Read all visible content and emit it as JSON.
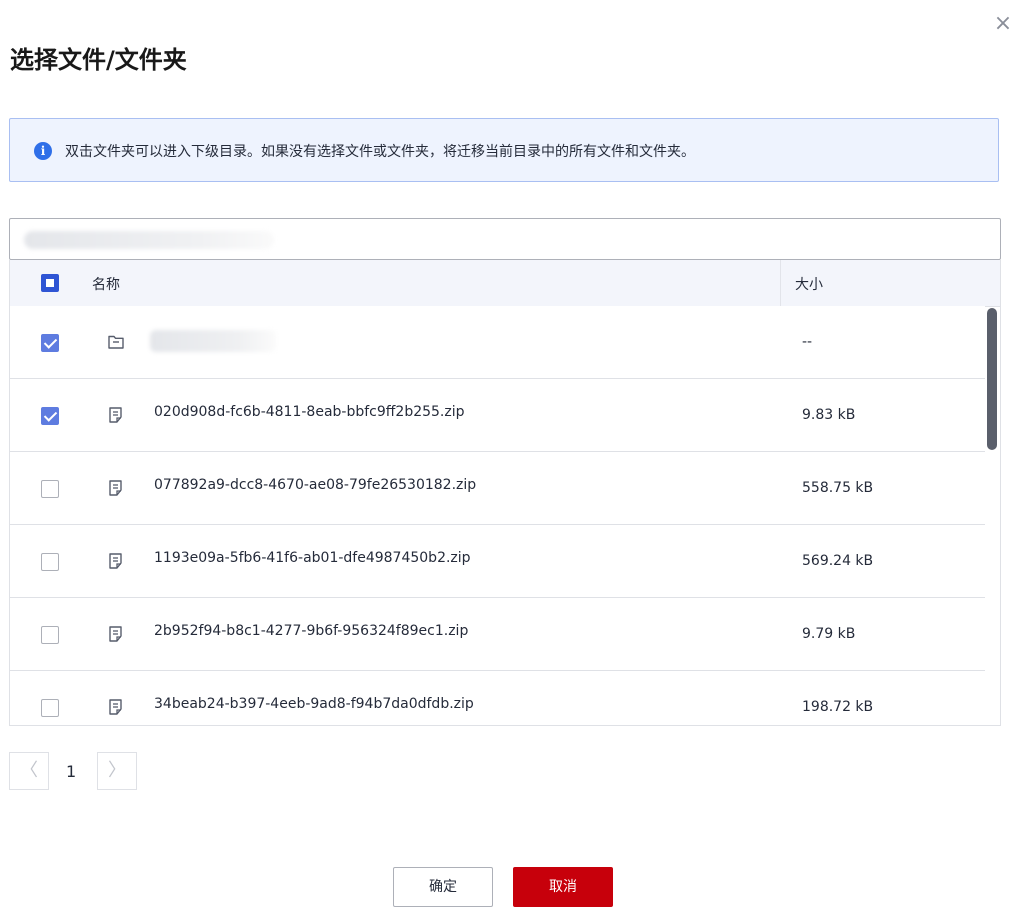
{
  "dialog": {
    "title": "选择文件/文件夹",
    "close_symbol": "×",
    "notice": "双击文件夹可以进入下级目录。如果没有选择文件或文件夹，将迁移当前目录中的所有文件和文件夹。"
  },
  "table": {
    "columns": {
      "name": "名称",
      "size": "大小"
    },
    "header_checkbox": "partial",
    "rows": [
      {
        "type": "folder",
        "icon": "folder-icon",
        "name": "",
        "size": "--",
        "checked": true
      },
      {
        "type": "file",
        "icon": "file-icon",
        "name": "020d908d-fc6b-4811-8eab-bbfc9ff2b255.zip",
        "size": "9.83 kB",
        "checked": true
      },
      {
        "type": "file",
        "icon": "file-icon",
        "name": "077892a9-dcc8-4670-ae08-79fe26530182.zip",
        "size": "558.75 kB",
        "checked": false
      },
      {
        "type": "file",
        "icon": "file-icon",
        "name": "1193e09a-5fb6-41f6-ab01-dfe4987450b2.zip",
        "size": "569.24 kB",
        "checked": false
      },
      {
        "type": "file",
        "icon": "file-icon",
        "name": "2b952f94-b8c1-4277-9b6f-956324f89ec1.zip",
        "size": "9.79 kB",
        "checked": false
      },
      {
        "type": "file",
        "icon": "file-icon",
        "name": "34beab24-b397-4eeb-9ad8-f94b7da0dfdb.zip",
        "size": "198.72 kB",
        "checked": false
      }
    ]
  },
  "pagination": {
    "current_page": "1",
    "prev_symbol": "〈",
    "next_symbol": "〉"
  },
  "buttons": {
    "ok": "确定",
    "cancel": "取消"
  },
  "colors": {
    "accent": "#5e7ce0",
    "danger": "#c7000b",
    "notice_bg": "#eef3fe"
  }
}
